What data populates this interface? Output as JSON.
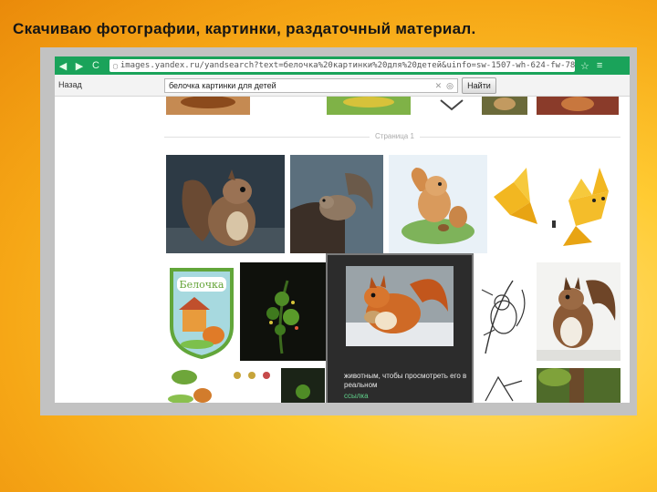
{
  "slide": {
    "title": "Скачиваю фотографии, картинки, раздаточный материал."
  },
  "browser": {
    "nav": {
      "back_arrow": "◀",
      "forward_arrow": "▶",
      "reload": "C"
    },
    "url": "images.yandex.ru/yandsearch?text=белочка%20картинки%20для%20детей&uinfo=sw-1507-wh-624-fw-782-fh-4",
    "star_icon": "☆",
    "menu_icon": "≡"
  },
  "search": {
    "back_label": "Назад",
    "query": "белочка картинки для детей",
    "clear_icon": "✕",
    "camera_icon": "◎",
    "find_label": "Найти"
  },
  "results": {
    "page_label": "Страница 1",
    "popup": {
      "text": "животным, чтобы просмотреть его в реальном",
      "link": "ссылка"
    }
  },
  "colors": {
    "chrome_green": "#1aa35a",
    "slide_bg_center": "#ffe17a",
    "slide_bg_edge": "#ea8a0a"
  }
}
